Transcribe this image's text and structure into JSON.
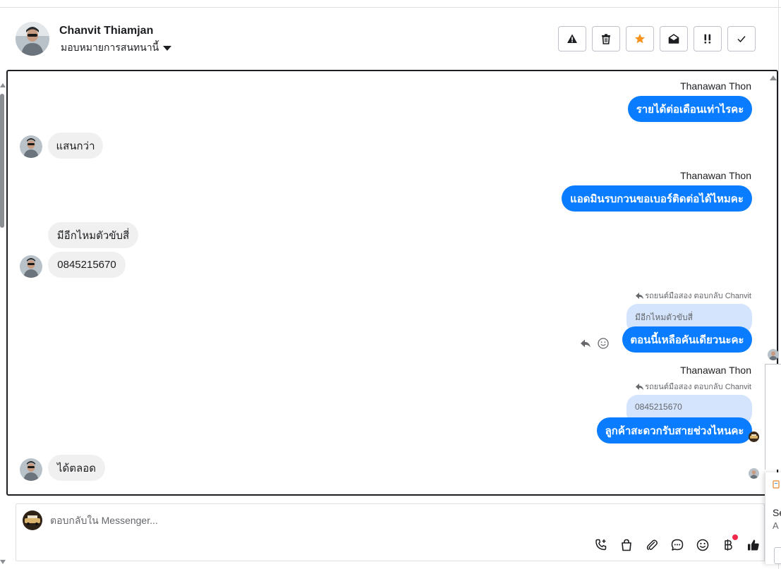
{
  "header": {
    "name": "Chanvit Thiamjan",
    "assign_label": "มอบหมายการสนทนานี้",
    "actions": [
      {
        "name": "spam-button",
        "icon": "warning-icon"
      },
      {
        "name": "delete-button",
        "icon": "trash-icon"
      },
      {
        "name": "star-button",
        "icon": "star-icon"
      },
      {
        "name": "mark-unread-button",
        "icon": "envelope-open-icon"
      },
      {
        "name": "follow-up-button",
        "icon": "double-exclamation-icon"
      },
      {
        "name": "mark-done-button",
        "icon": "check-icon"
      }
    ]
  },
  "conversation": {
    "sender_name": "Thanawan Thon",
    "messages": {
      "m1": "รายได้ต่อเดือนเท่าไรคะ",
      "m2": "แสนกว่า",
      "m3": "แอดมินรบกวนขอเบอร์ติดต่อได้ไหมคะ",
      "m4": "มีอีกไหมตัวขับสี่",
      "m5": "0845215670",
      "m6_reply_note": "รถยนต์มือสอง ตอบกลับ Chanvit",
      "m6_quote": "มีอีกไหมตัวขับสี่",
      "m6": "ตอนนี้เหลือคันเดียวนะคะ",
      "m7_reply_note": "รถยนต์มือสอง ตอบกลับ Chanvit",
      "m7_quote": "0845215670",
      "m7": "ลูกค้าสะดวกรับสายช่วงไหนคะ",
      "m8": "ได้ตลอด"
    }
  },
  "composer": {
    "placeholder": "ตอบกลับใน Messenger..."
  },
  "side": {
    "text1": "Se",
    "text2": "A"
  },
  "colors": {
    "brand_blue": "#0a7cff",
    "quote_bg": "#d4e4fc",
    "incoming_bg": "#f0f0f0",
    "star": "#f7931e",
    "notification_dot": "#f02849"
  }
}
